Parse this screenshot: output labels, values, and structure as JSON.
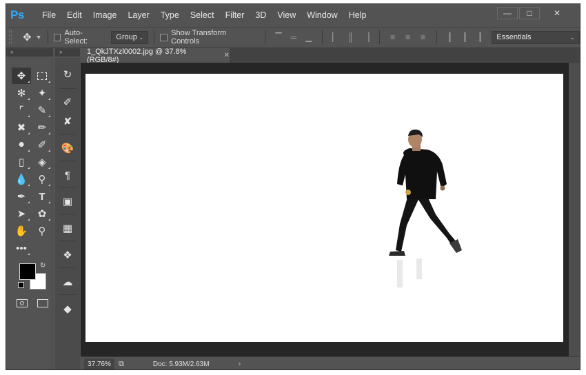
{
  "app": {
    "logo": "Ps"
  },
  "menu": [
    "File",
    "Edit",
    "Image",
    "Layer",
    "Type",
    "Select",
    "Filter",
    "3D",
    "View",
    "Window",
    "Help"
  ],
  "window_controls": {
    "minimize_icon": "minimize-icon",
    "restore_icon": "restore-icon",
    "close_icon": "close-icon"
  },
  "options_bar": {
    "auto_select_label": "Auto-Select:",
    "auto_select_checked": false,
    "group_value": "Group",
    "show_transform_label": "Show Transform Controls",
    "show_transform_checked": false,
    "workspace_value": "Essentials"
  },
  "document": {
    "tab_title": "1_QkJTXzl0002.jpg @ 37.8% (RGB/8#)",
    "zoom": "37.76%",
    "doc_info": "Doc: 5.93M/2.63M"
  },
  "tools": {
    "icons": [
      "move-tool-icon",
      "marquee-tool-icon",
      "lasso-tool-icon",
      "quick-select-tool-icon",
      "crop-tool-icon",
      "eyedropper-tool-icon",
      "healing-brush-icon",
      "brush-tool-icon",
      "clone-stamp-icon",
      "history-brush-icon",
      "eraser-tool-icon",
      "paint-bucket-icon",
      "blur-tool-icon",
      "dodge-tool-icon",
      "pen-tool-icon",
      "type-tool-icon",
      "path-select-icon",
      "custom-shape-icon",
      "hand-tool-icon",
      "zoom-tool-icon",
      "more-tools-icon"
    ],
    "foreground_color": "#000000",
    "background_color": "#ffffff"
  },
  "panel_icons": [
    "history-panel-icon",
    "brush-settings-icon",
    "tool-presets-icon",
    "swatches-icon",
    "character-panel-icon",
    "properties-icon",
    "grid-icon",
    "paths-icon",
    "libraries-icon",
    "layers-icon"
  ],
  "colors": {
    "ui_bg": "#535353",
    "canvas_bg": "#262626",
    "accent": "#31a8ff"
  }
}
